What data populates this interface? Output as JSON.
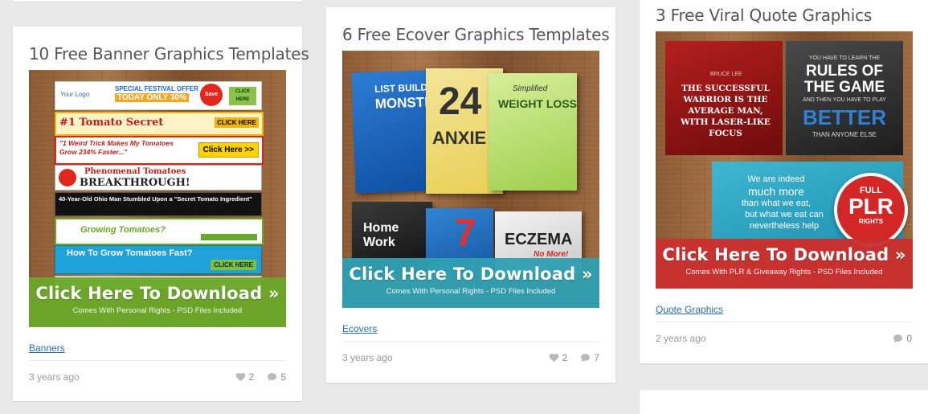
{
  "cards": [
    {
      "title": "10 Free Banner Graphics Templates",
      "download_label": "Click Here To Download »",
      "download_sub": "Comes With Personal Rights - PSD Files Included",
      "category": "Banners",
      "time": "3 years ago",
      "likes": "2",
      "comments": "5",
      "bar_color": "#6aa829"
    },
    {
      "title": "6 Free Ecover Graphics Templates",
      "download_label": "Click Here To Download »",
      "download_sub": "Comes With Personal Rights - PSD Files Included",
      "category": "Ecovers",
      "time": "3 years ago",
      "likes": "2",
      "comments": "7",
      "bar_color": "#2f9fb1"
    },
    {
      "title": "3 Free Viral Quote Graphics",
      "download_label": "Click Here To Download »",
      "download_sub": "Comes With PLR & Giveaway Rights - PSD Files Included",
      "category": "Quote Graphics",
      "time": "2 years ago",
      "comments": "0",
      "bar_color": "#c9302f"
    }
  ],
  "banner_thumb": {
    "logo": "Your Logo",
    "festival": "SPECIAL FESTIVAL OFFER",
    "today": "TODAY ONLY 30%",
    "save": "Save 30%",
    "click_here": "CLICK HERE",
    "tomato_secret": "#1 Tomato Secret",
    "weird_trick": "\"1 Weird Trick Makes My Tomatoes Grow 234% Faster...\"",
    "click_here_arrow": "Click Here >>",
    "phenomenal": "Phenomenal Tomatoes",
    "breakthrough": "BREAKTHROUGH!",
    "ohio": "40-Year-Old Ohio Man Stumbled Upon a \"Secret Tomato Ingredient\"",
    "growing": "Growing Tomatoes?",
    "how_to": "How To Grow Tomatoes Fast?",
    "click_here_small": "CLICK HERE"
  },
  "ecover_thumb": {
    "list_build": "LIST BUILD",
    "monster": "MONSTE",
    "num_24": "24",
    "anxiety": "ANXIE",
    "simplified": "Simplified",
    "weight_loss": "WEIGHT LOSS",
    "home_work": "Home Work",
    "num_7": "7",
    "eczema": "ECZEMA",
    "no_more": "No More!"
  },
  "quote_thumb": {
    "q1": "THE SUCCESSFUL WARRIOR IS THE AVERAGE MAN, WITH LASER-LIKE FOCUS",
    "q1_author": "BRUCE LEE",
    "q2_top": "YOU HAVE TO LEARN THE",
    "q2_big": "RULES OF THE GAME",
    "q2_mid": "AND THEN YOU HAVE TO PLAY",
    "q2_better": "BETTER",
    "q2_bottom": "THAN ANYONE ELSE",
    "q3_a": "We are indeed",
    "q3_b": "much more",
    "q3_c": "than what we eat,",
    "q3_d": "but what we eat can",
    "q3_e": "nevertheless help",
    "plr_full": "FULL",
    "plr": "PLR",
    "plr_rights": "RIGHTS"
  },
  "colors": {
    "link": "#2a6db5",
    "meta": "#999999",
    "background": "#e9e9e9"
  }
}
